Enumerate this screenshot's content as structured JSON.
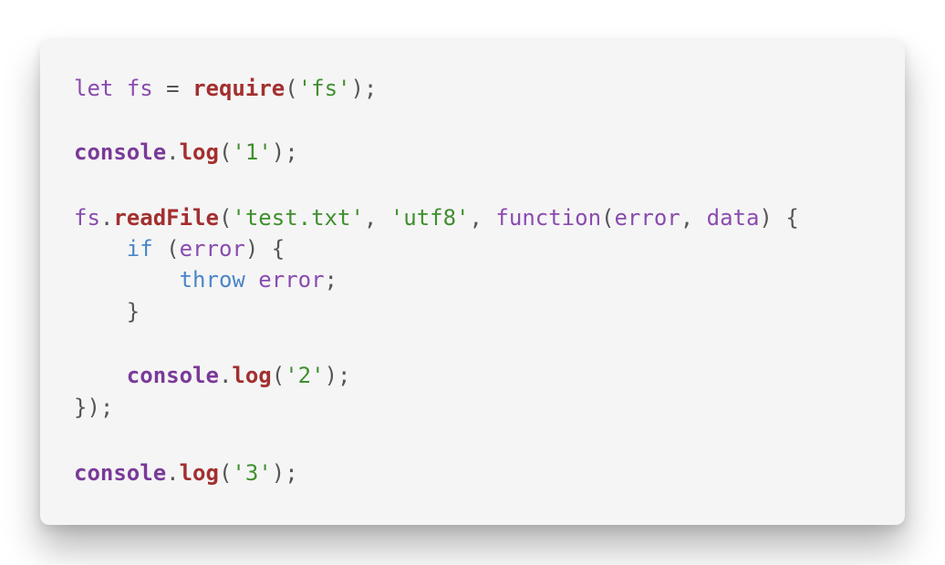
{
  "code_snippet": {
    "lines": [
      [
        {
          "t": "let",
          "c": "kw"
        },
        {
          "t": " ",
          "c": "punc"
        },
        {
          "t": "fs",
          "c": "var"
        },
        {
          "t": " = ",
          "c": "op"
        },
        {
          "t": "require",
          "c": "fn"
        },
        {
          "t": "(",
          "c": "punc"
        },
        {
          "t": "'fs'",
          "c": "str"
        },
        {
          "t": ");",
          "c": "punc"
        }
      ],
      [],
      [
        {
          "t": "console",
          "c": "obj"
        },
        {
          "t": ".",
          "c": "punc"
        },
        {
          "t": "log",
          "c": "fn"
        },
        {
          "t": "(",
          "c": "punc"
        },
        {
          "t": "'1'",
          "c": "str"
        },
        {
          "t": ");",
          "c": "punc"
        }
      ],
      [],
      [
        {
          "t": "fs",
          "c": "var"
        },
        {
          "t": ".",
          "c": "punc"
        },
        {
          "t": "readFile",
          "c": "fn"
        },
        {
          "t": "(",
          "c": "punc"
        },
        {
          "t": "'test.txt'",
          "c": "str"
        },
        {
          "t": ", ",
          "c": "punc"
        },
        {
          "t": "'utf8'",
          "c": "str"
        },
        {
          "t": ", ",
          "c": "punc"
        },
        {
          "t": "function",
          "c": "kw"
        },
        {
          "t": "(",
          "c": "punc"
        },
        {
          "t": "error",
          "c": "var"
        },
        {
          "t": ", ",
          "c": "punc"
        },
        {
          "t": "data",
          "c": "var"
        },
        {
          "t": ") {",
          "c": "punc"
        }
      ],
      [
        {
          "t": "    ",
          "c": "punc"
        },
        {
          "t": "if",
          "c": "kw2"
        },
        {
          "t": " (",
          "c": "punc"
        },
        {
          "t": "error",
          "c": "var"
        },
        {
          "t": ") {",
          "c": "punc"
        }
      ],
      [
        {
          "t": "        ",
          "c": "punc"
        },
        {
          "t": "throw",
          "c": "kw2"
        },
        {
          "t": " ",
          "c": "punc"
        },
        {
          "t": "error",
          "c": "var"
        },
        {
          "t": ";",
          "c": "punc"
        }
      ],
      [
        {
          "t": "    }",
          "c": "punc"
        }
      ],
      [],
      [
        {
          "t": "    ",
          "c": "punc"
        },
        {
          "t": "console",
          "c": "obj"
        },
        {
          "t": ".",
          "c": "punc"
        },
        {
          "t": "log",
          "c": "fn"
        },
        {
          "t": "(",
          "c": "punc"
        },
        {
          "t": "'2'",
          "c": "str"
        },
        {
          "t": ");",
          "c": "punc"
        }
      ],
      [
        {
          "t": "});",
          "c": "punc"
        }
      ],
      [],
      [
        {
          "t": "console",
          "c": "obj"
        },
        {
          "t": ".",
          "c": "punc"
        },
        {
          "t": "log",
          "c": "fn"
        },
        {
          "t": "(",
          "c": "punc"
        },
        {
          "t": "'3'",
          "c": "str"
        },
        {
          "t": ");",
          "c": "punc"
        }
      ]
    ]
  },
  "colors": {
    "card_background": "#f5f5f5",
    "keyword": "#8a4bb0",
    "control_keyword": "#4a86c8",
    "function": "#a32f2f",
    "string": "#3f8f2e",
    "punctuation": "#555555"
  }
}
